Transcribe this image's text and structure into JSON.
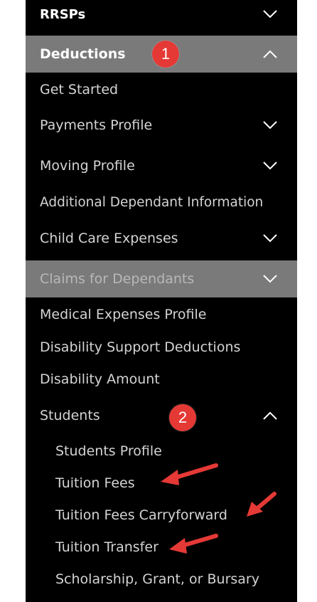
{
  "nav": {
    "rrsps": "RRSPs",
    "deductions": "Deductions",
    "get_started": "Get Started",
    "payments_profile": "Payments Profile",
    "moving_profile": "Moving Profile",
    "additional_dependant": "Additional Dependant Information",
    "child_care": "Child Care Expenses",
    "claims_dependants": "Claims for Dependants",
    "medical_expenses": "Medical Expenses Profile",
    "disability_support": "Disability Support Deductions",
    "disability_amount": "Disability Amount",
    "students": "Students",
    "students_children": {
      "students_profile": "Students Profile",
      "tuition_fees": "Tuition Fees",
      "tuition_carryforward": "Tuition Fees Carryforward",
      "tuition_transfer": "Tuition Transfer",
      "scholarship": "Scholarship, Grant, or Bursary"
    }
  },
  "annotations": {
    "badge_1": "1",
    "badge_2": "2",
    "badge_color": "#e53935",
    "arrow_color": "#e53935"
  },
  "colors": {
    "sidebar_bg": "#000000",
    "selected_bg": "#7a7a7b",
    "text": "#d4d4d4"
  },
  "icons": [
    "chevron-down-icon",
    "chevron-up-icon"
  ]
}
